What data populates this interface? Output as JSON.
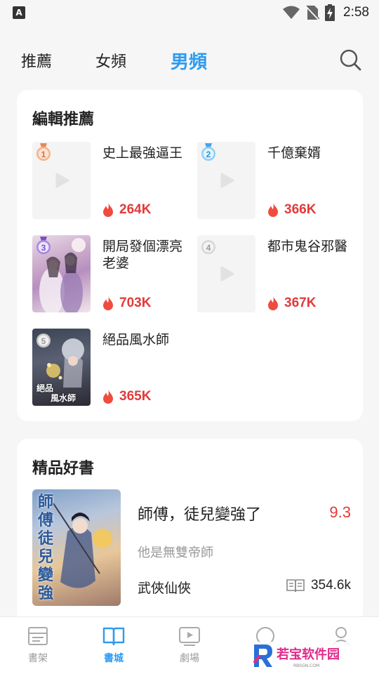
{
  "status_bar": {
    "time": "2:58",
    "badge": "A"
  },
  "top_tabs": [
    {
      "label": "推薦"
    },
    {
      "label": "女頻"
    },
    {
      "label": "男頻"
    }
  ],
  "editor_picks": {
    "title": "編輯推薦",
    "books": [
      {
        "rank": "1",
        "title": "史上最強逼王",
        "heat": "264K"
      },
      {
        "rank": "2",
        "title": "千億棄婿",
        "heat": "366K"
      },
      {
        "rank": "3",
        "title": "開局發個漂亮老婆",
        "heat": "703K"
      },
      {
        "rank": "4",
        "title": "都市鬼谷邪醫",
        "heat": "367K"
      },
      {
        "rank": "5",
        "title": "絕品風水師",
        "heat": "365K",
        "cover_text": [
          "絕品",
          "風水師"
        ]
      }
    ]
  },
  "premium": {
    "title": "精品好書",
    "book": {
      "title": "師傅，徒兒變強了",
      "score": "9.3",
      "subtitle": "他是無雙帝師",
      "genre": "武俠仙俠",
      "reads": "354.6k",
      "cover_text": "師傅徒兒變強"
    }
  },
  "bottom_nav": [
    {
      "label": "書架",
      "icon": "bookshelf-icon"
    },
    {
      "label": "書城",
      "icon": "open-book-icon"
    },
    {
      "label": "劇場",
      "icon": "video-icon"
    },
    {
      "label": "",
      "icon": "circle-icon"
    },
    {
      "label": "",
      "icon": "user-icon"
    }
  ],
  "watermark": {
    "brand": "若宝软件园",
    "url": "RBSGN.COM"
  },
  "colors": {
    "accent": "#2f9bf0",
    "heat": "#e23a3a"
  }
}
